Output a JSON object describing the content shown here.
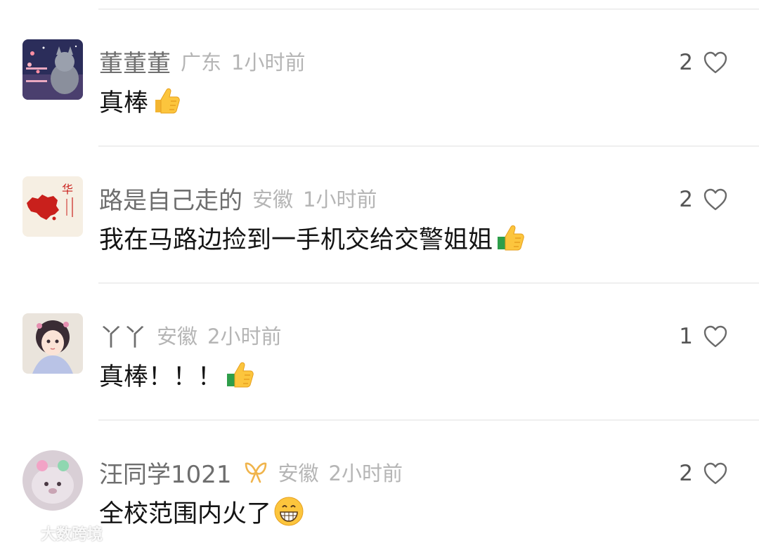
{
  "comments": [
    {
      "username": "董董董",
      "location": "广东",
      "time": "1小时前",
      "text": "真棒",
      "emoji": "thumbs-up",
      "likes": "2",
      "avatar": "cat-night-avatar"
    },
    {
      "username": "路是自己走的",
      "location": "安徽",
      "time": "1小时前",
      "text": "我在马路边捡到一手机交给交警姐姐",
      "emoji": "thumbs-up",
      "likes": "2",
      "avatar": "china-map-avatar"
    },
    {
      "username": "丫丫",
      "location": "安徽",
      "time": "2小时前",
      "text": "真棒！！！",
      "emoji": "thumbs-up",
      "likes": "1",
      "avatar": "anime-girl-avatar"
    },
    {
      "username": "汪同学1021",
      "location": "安徽",
      "time": "2小时前",
      "text": "全校范围内火了",
      "emoji": "grinning-face",
      "likes": "2",
      "avatar": "plush-animal-avatar",
      "badge": "bow-badge-icon"
    }
  ],
  "watermark": {
    "text": "大数跨境"
  },
  "colors": {
    "username": "#6e6e6e",
    "meta": "#b5b5b5",
    "text": "#141414",
    "divider": "#efefef",
    "heart": "#6a6a6a",
    "badge": "#f0b44c"
  }
}
